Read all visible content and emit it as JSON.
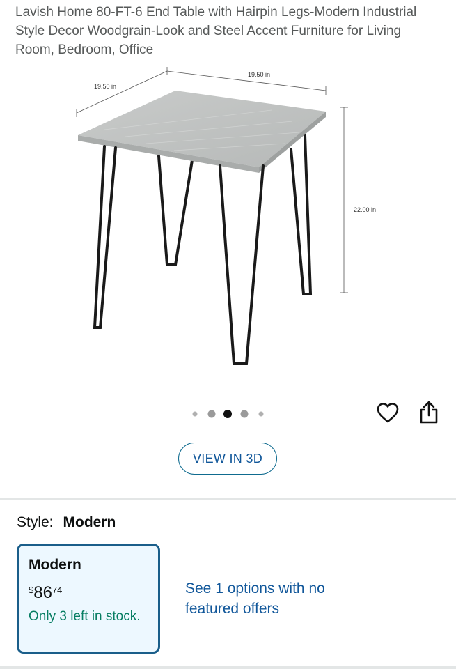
{
  "product": {
    "title": "Lavish Home 80-FT-6 End Table with Hairpin Legs-Modern Industrial Style Decor Woodgrain-Look and Steel Accent Furniture for Living Room, Bedroom, Office"
  },
  "image": {
    "dim_width_top": "19.50 in",
    "dim_width_left": "19.50 in",
    "dim_height": "22.00 in",
    "carousel_count": 5,
    "carousel_active_index": 2
  },
  "actions": {
    "favorite_icon": "heart-outline-icon",
    "share_icon": "share-icon",
    "view3d_label": "VIEW IN 3D"
  },
  "style": {
    "key_label": "Style:",
    "value": "Modern",
    "selected_option": {
      "name": "Modern",
      "currency_symbol": "$",
      "price_whole": "86",
      "price_fraction": "74",
      "stock_text": "Only 3 left in stock."
    },
    "see_options_text": "See 1 options with no featured offers"
  },
  "colors": {
    "link": "#11579a",
    "stock_green": "#067d62",
    "swatch_border": "#1a5e8a",
    "swatch_bg": "#edf8ff"
  }
}
